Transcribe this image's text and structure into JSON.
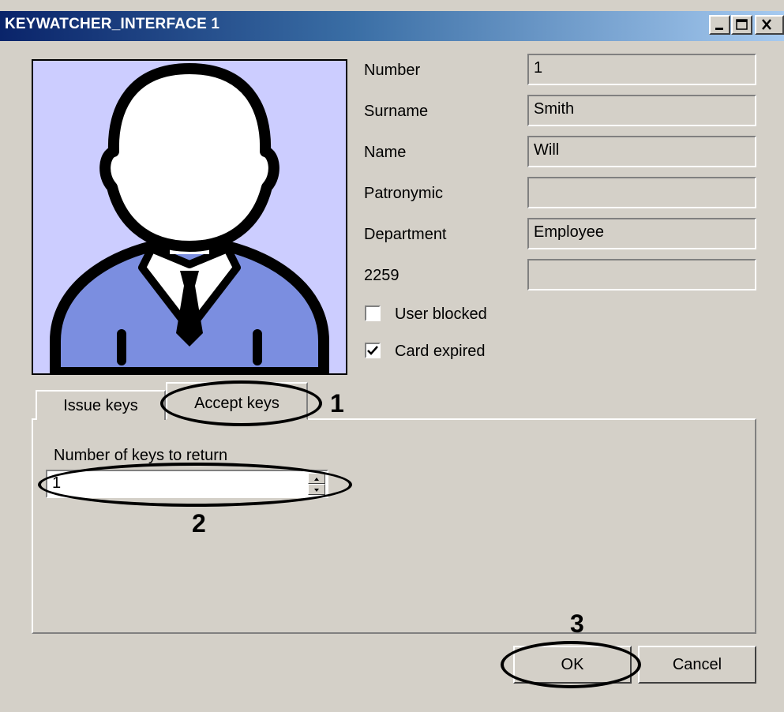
{
  "window": {
    "title": "KEYWATCHER_INTERFACE 1",
    "controls": {
      "minimize_icon": "minimize-icon",
      "maximize_icon": "maximize-icon",
      "close_icon": "close-icon"
    }
  },
  "photo": {
    "icon": "user-avatar-icon"
  },
  "fields": [
    {
      "label": "Number",
      "value": "1"
    },
    {
      "label": "Surname",
      "value": "Smith"
    },
    {
      "label": "Name",
      "value": "Will"
    },
    {
      "label": "Patronymic",
      "value": ""
    },
    {
      "label": "Department",
      "value": "Employee"
    },
    {
      "label": "2259",
      "value": ""
    }
  ],
  "checkboxes": [
    {
      "label": "User blocked",
      "checked": false
    },
    {
      "label": "Card expired",
      "checked": true
    }
  ],
  "tabs": {
    "issue": "Issue keys",
    "accept": "Accept keys",
    "active": "accept"
  },
  "accept_panel": {
    "label": "Number of keys to return",
    "value": "1"
  },
  "buttons": {
    "ok": "OK",
    "cancel": "Cancel"
  },
  "annotations": {
    "tab": "1",
    "spin": "2",
    "ok": "3"
  },
  "colors": {
    "title_start": "#0a246a",
    "title_end": "#a6caf0",
    "face": "#d4d0c8",
    "photo_bg": "#cccdff",
    "shirt": "#7b8ee0"
  }
}
